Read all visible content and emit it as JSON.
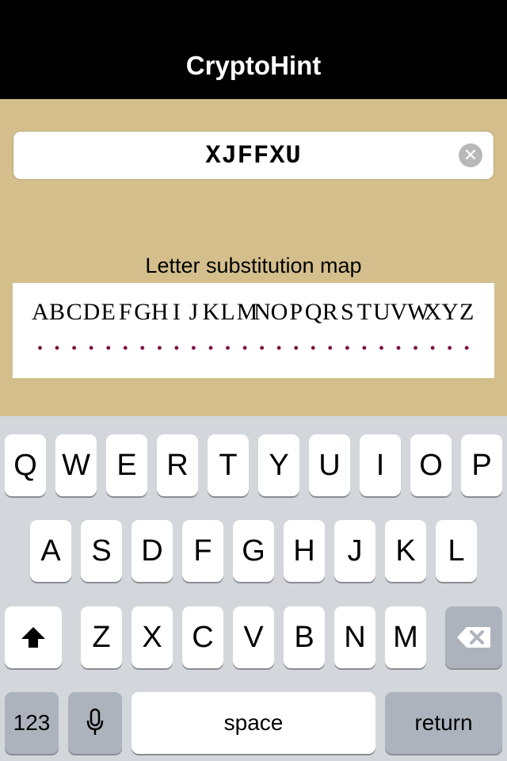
{
  "navbar": {
    "title": "CryptoHint"
  },
  "cipher_input": {
    "value": "XJFFXU",
    "clear_icon": "clear-circle-icon"
  },
  "map": {
    "label": "Letter substitution map",
    "letters": [
      "A",
      "B",
      "C",
      "D",
      "E",
      "F",
      "G",
      "H",
      "I",
      "J",
      "K",
      "L",
      "M",
      "N",
      "O",
      "P",
      "Q",
      "R",
      "S",
      "T",
      "U",
      "V",
      "W",
      "X",
      "Y",
      "Z"
    ],
    "placeholders": [
      ".",
      ".",
      ".",
      ".",
      ".",
      ".",
      ".",
      ".",
      ".",
      ".",
      ".",
      ".",
      ".",
      ".",
      ".",
      ".",
      ".",
      ".",
      ".",
      ".",
      ".",
      ".",
      ".",
      ".",
      ".",
      "."
    ]
  },
  "keyboard": {
    "row1": [
      "Q",
      "W",
      "E",
      "R",
      "T",
      "Y",
      "U",
      "I",
      "O",
      "P"
    ],
    "row2": [
      "A",
      "S",
      "D",
      "F",
      "G",
      "H",
      "J",
      "K",
      "L"
    ],
    "row3": [
      "Z",
      "X",
      "C",
      "V",
      "B",
      "N",
      "M"
    ],
    "numbers_label": "123",
    "space_label": "space",
    "return_label": "return",
    "colors": {
      "background": "#d3d6db",
      "key": "#ffffff",
      "dark_key": "#adb3bd"
    }
  },
  "colors": {
    "navbar": "#000000",
    "content_bg": "#d4bf8c",
    "dot_color": "#7a1040"
  }
}
